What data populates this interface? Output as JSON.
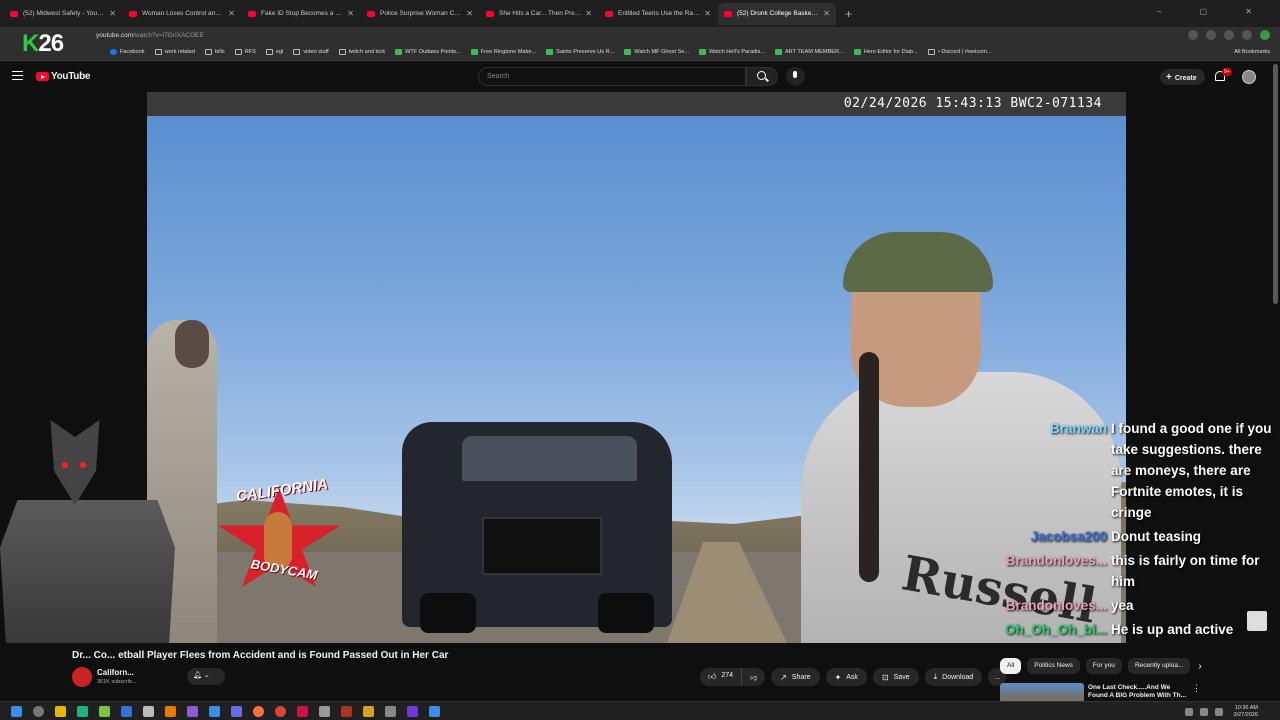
{
  "browser": {
    "tabs": [
      {
        "title": "(52) Midwest Safety - YouTube",
        "active": false
      },
      {
        "title": "Woman Loses Control and Ca...",
        "active": false
      },
      {
        "title": "Fake ID Stop Becomes a Full-B...",
        "active": false
      },
      {
        "title": "Police Surprise Woman Carryin...",
        "active": false
      },
      {
        "title": "She Hits a Car... Then Pretends...",
        "active": false
      },
      {
        "title": "Entitled Teens Use the Race Ca...",
        "active": false
      },
      {
        "title": "(52) Drunk College Basketb...",
        "active": true
      }
    ],
    "new_tab": "+",
    "url_host": "youtube.com",
    "url_path": "/watch?v=l7GrIXACOEE",
    "bookmarks": [
      {
        "label": "Facebook",
        "icon": "facebook-icon"
      },
      {
        "label": "work related",
        "icon": "folder-icon"
      },
      {
        "label": "bills",
        "icon": "folder-icon"
      },
      {
        "label": "RFS",
        "icon": "folder-icon"
      },
      {
        "label": "egl",
        "icon": "folder-icon"
      },
      {
        "label": "video stuff",
        "icon": "folder-icon"
      },
      {
        "label": "twitch and kick",
        "icon": "folder-icon"
      },
      {
        "label": "WTF Outlaws Points...",
        "icon": "site-icon"
      },
      {
        "label": "Free Ringtone Make...",
        "icon": "site-icon"
      },
      {
        "label": "Saints Preserve Us R...",
        "icon": "site-icon"
      },
      {
        "label": "Watch MF Ghost Se...",
        "icon": "site-icon"
      },
      {
        "label": "Watch Hell's Paradis...",
        "icon": "site-icon"
      },
      {
        "label": "ART TEAM MEMBER...",
        "icon": "site-icon"
      },
      {
        "label": "Hero Editor for Diab...",
        "icon": "site-icon"
      },
      {
        "label": "• Discord | #welcom...",
        "icon": "discord-icon"
      }
    ],
    "all_bookmarks": "All Bookmarks"
  },
  "overlay": {
    "k": "K",
    "num": "26"
  },
  "youtube": {
    "logo": "YouTube",
    "search_placeholder": "Search",
    "create": "Create",
    "notif_count": "9+"
  },
  "video": {
    "timestamp": "02/24/2026 15:43:13 BWC2-071134",
    "logo_top": "CALIFORNIA",
    "logo_bottom": "BODYCAM",
    "shirt_print": "Russell",
    "title": "Dr... Co... etball Player Flees from Accident and is Found Passed Out in Her Car",
    "channel": "Californ...",
    "subs": "361K subscrib...",
    "likes": "274",
    "share": "Share",
    "ask": "Ask",
    "save": "Save",
    "download": "Download",
    "more": "..."
  },
  "chat": [
    {
      "name": "Branwan",
      "color": "#7fd6ff",
      "text": "I found a good one if you take suggestions. there are moneys, there are Fortnite emotes, it is cringe"
    },
    {
      "name": "Jacobsa200",
      "color": "#3a6fd8",
      "text": "Donut teasing"
    },
    {
      "name": "Brandonloves...",
      "color": "#e8a0b8",
      "text": "this is fairly on time for him"
    },
    {
      "name": "Brandonloves...",
      "color": "#e8a0b8",
      "text": "yea"
    },
    {
      "name": "Oh_Oh_Oh_bl...",
      "color": "#2ecc71",
      "text": "He is up and active"
    }
  ],
  "sidebar": {
    "chips": [
      {
        "label": "All",
        "selected": true
      },
      {
        "label": "Politics News",
        "selected": false
      },
      {
        "label": "For you",
        "selected": false
      },
      {
        "label": "Recently uploa...",
        "selected": false
      }
    ],
    "rec_title": "One Last Check.....And We Found A BIG Problem With Th..."
  },
  "taskbar": {
    "time": "10:36 AM",
    "date": "3/27/2026"
  }
}
